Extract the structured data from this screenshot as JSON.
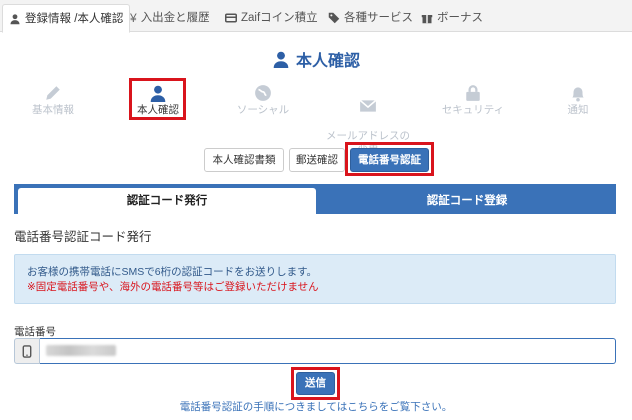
{
  "topnav": {
    "tabs": [
      {
        "label": "登録情報 /本人確認",
        "icon": "user-icon",
        "active": true
      },
      {
        "label": "入出金と履歴",
        "icon": "yen-icon",
        "active": false
      },
      {
        "label": "Zaifコイン積立",
        "icon": "card-icon",
        "active": false
      },
      {
        "label": "各種サービス",
        "icon": "tag-icon",
        "active": false
      },
      {
        "label": "ボーナス",
        "icon": "gift-icon",
        "active": false
      }
    ]
  },
  "page_title": "本人確認",
  "steps": [
    {
      "label": "基本情報",
      "icon": "pencil-icon",
      "active": false
    },
    {
      "label": "本人確認",
      "icon": "user-icon",
      "active": true
    },
    {
      "label": "ソーシャル",
      "icon": "globe-icon",
      "active": false
    },
    {
      "label": "メールアドレスの\n変更",
      "icon": "envelope-icon",
      "active": false
    },
    {
      "label": "セキュリティ",
      "icon": "lock-icon",
      "active": false
    },
    {
      "label": "通知",
      "icon": "bell-icon",
      "active": false
    }
  ],
  "sub_buttons": [
    {
      "label": "本人確認書類",
      "active": false
    },
    {
      "label": "郵送確認",
      "active": false
    },
    {
      "label": "電話番号認証",
      "active": true
    }
  ],
  "code_tabs": [
    {
      "label": "認証コード発行",
      "active": true
    },
    {
      "label": "認証コード登録",
      "active": false
    }
  ],
  "section_heading": "電話番号認証コード発行",
  "info": {
    "line1": "お客様の携帯電話にSMSで6桁の認証コードをお送りします。",
    "line2": "※固定電話番号や、海外の電話番号等はご登録いただけません"
  },
  "phone": {
    "label": "電話番号",
    "value": ""
  },
  "send_label": "送信",
  "help_link": "電話番号認証の手順につきましてはこちらをご覧下さい。",
  "colors": {
    "accent": "#3a72b8",
    "highlight_frame": "#d9141c",
    "info_bg": "#dcebf7"
  }
}
